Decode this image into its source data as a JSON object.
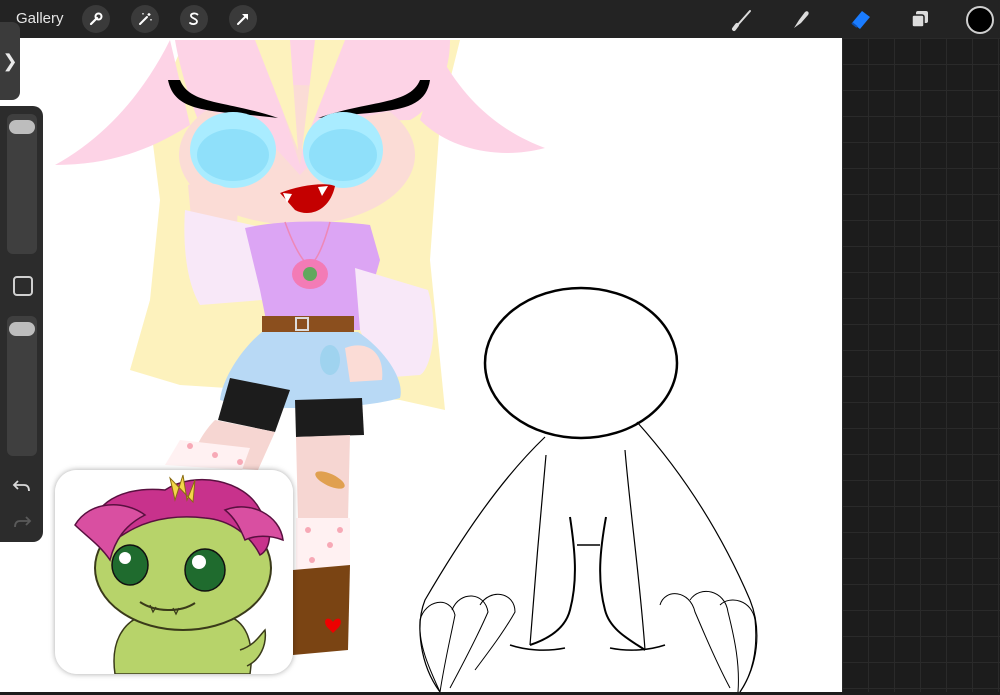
{
  "app": {
    "gallery_label": "Gallery"
  },
  "toolbar": {
    "left_tools": [
      {
        "name": "actions",
        "icon": "wrench-icon"
      },
      {
        "name": "adjustments",
        "icon": "magic-wand-icon"
      },
      {
        "name": "selection",
        "icon": "selection-s-icon"
      },
      {
        "name": "transform",
        "icon": "arrow-cursor-icon"
      }
    ],
    "right_tools": [
      {
        "name": "brush",
        "icon": "brush-icon",
        "active": false
      },
      {
        "name": "smudge",
        "icon": "smudge-icon",
        "active": false
      },
      {
        "name": "eraser",
        "icon": "eraser-icon",
        "active": true
      },
      {
        "name": "layers",
        "icon": "layers-icon",
        "active": false
      }
    ],
    "active_color": "#000000",
    "accent_color": "#1a7cff"
  },
  "sidebar": {
    "size_slider_level": 0,
    "opacity_slider_level": 0,
    "expand_glyph": "❯"
  },
  "canvas": {
    "background": "#ffffff"
  }
}
